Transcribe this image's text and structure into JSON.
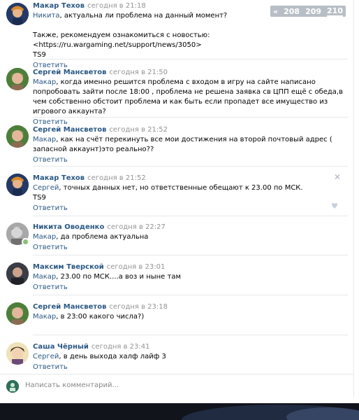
{
  "pager": {
    "pages": [
      "208",
      "209",
      "210"
    ],
    "current": "210",
    "prev_symbol": "«"
  },
  "comments": [
    {
      "author": "Макар Техов",
      "time": "сегодня в 21:18",
      "mention": "Никита",
      "text": ", актуальна ли проблема на данный момент?",
      "extra1": "Также, рекомендуем ознакомиться с новостью: <https://ru.wargaming.net/support/news/3050>",
      "extra2": "TS9",
      "reply": "Ответить"
    },
    {
      "author": "Сергей Мансветов",
      "time": "сегодня в 21:50",
      "mention": "Макар",
      "text": ", когда именно решится проблема с входом в игру на сайте написано попробовать зайти после 18:00 , проблема не решена заявка св ЦПП ещё с обеда,в чем собственно обстоит проблема и как быть если пропадет все имущество из игрового аккаунта?",
      "reply": "Ответить"
    },
    {
      "author": "Сергей Мансветов",
      "time": "сегодня в 21:52",
      "mention": "Макар",
      "text": ", как на счёт перекинуть все мои достижения на второй почтовый адрес ( запасной аккаунт)это реально??",
      "reply": "Ответить"
    },
    {
      "author": "Макар Техов",
      "time": "сегодня в 21:52",
      "mention": "Сергей",
      "text": ", точных данных нет, но ответственные обещают к 23.00 по МСК.",
      "extra2": "TS9",
      "reply": "Ответить"
    },
    {
      "author": "Никита Оводенко",
      "time": "сегодня в 22:27",
      "mention": "Макар",
      "text": ", да проблема актуальна",
      "reply": "Ответить"
    },
    {
      "author": "Максим Тверской",
      "time": "сегодня в 23:01",
      "mention": "Макар",
      "text": ", 23.00 по МСК....а воз и ныне там",
      "reply": "Ответить"
    },
    {
      "author": "Сергей Мансветов",
      "time": "сегодня в 23:18",
      "mention": "Макар",
      "text": ", в 23:00 какого числа?)",
      "reply": "Ответить"
    },
    {
      "author": "Саша Чёрный",
      "time": "сегодня в 23:41",
      "mention": "Сергей",
      "text": ", в день выхода халф лайф 3",
      "reply": "Ответить"
    }
  ],
  "composer": {
    "placeholder": "Написать комментарий..."
  },
  "icons": {
    "close": "close-icon",
    "like": "heart-icon"
  },
  "colors": {
    "link": "#2a5885",
    "muted": "#939393",
    "online": "#8ac176"
  }
}
